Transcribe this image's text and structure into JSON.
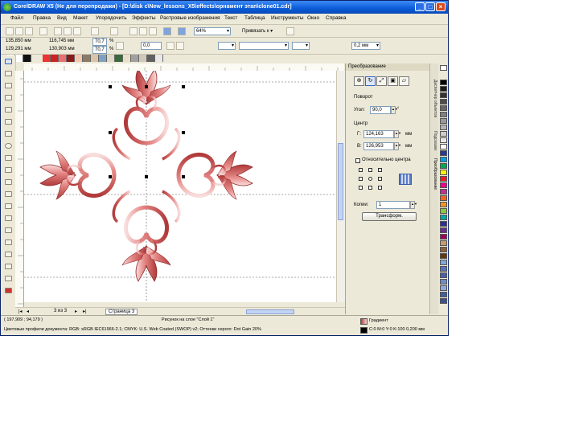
{
  "window": {
    "title": "CorelDRAW X5 (Не для перепродажи) - [D:\\disk c\\New_lessons_X5\\effects\\орнамент этап\\clone01.cdr]",
    "min_label": "_",
    "max_label": "□",
    "close_label": "×"
  },
  "menu": [
    "Файл",
    "Правка",
    "Вид",
    "Макет",
    "Упорядочить",
    "Эффекты",
    "Растровые изображения",
    "Текст",
    "Таблица",
    "Инструменты",
    "Окно",
    "Справка"
  ],
  "toolbar": {
    "zoom": "64%",
    "snap_label": "Привязать к ▾"
  },
  "property_bar": {
    "x": "135,850 мм",
    "y": "129,291 мм",
    "width": "116,745 мм",
    "height": "130,903 мм",
    "scale_x": "70,7",
    "scale_y": "70,7",
    "pct": "%",
    "rotation": "0,0",
    "outline": "0,2 мм"
  },
  "docker": {
    "title": "Преобразование",
    "rotation_heading": "Поворот",
    "angle_label": "Угол:",
    "angle_value": "90,0",
    "degree": "°",
    "center_heading": "Центр",
    "cx_label": "Г:",
    "cx_value": "124,163",
    "cy_label": "В:",
    "cy_value": "126,953",
    "unit": "мм",
    "relative_label": "Относительно центра",
    "copies_label": "Копии:",
    "copies_value": "1",
    "apply_button": "Трансформ."
  },
  "side_tabs": [
    "Диспетчер объектов",
    "Подсказки",
    "Преобразование"
  ],
  "page_nav": {
    "counter": "3 из 3",
    "page_tab": "Страница 3"
  },
  "status": {
    "left_line1": "( 197,909 ; 94,179 )",
    "selection_text": "Рисунок на слое \"Слой 1\"",
    "left_line2": "Цветовые профили документа: RGB: sRGB IEC61966-2.1; CMYK: U.S. Web Coated (SWOP) v2; Оттенки серого: Dot Gain 20%",
    "fill_label": "Градиент",
    "outline_label": "C:0 M:0 Y:0 K:100  0,200 мм"
  },
  "colors": {
    "ornament_dark": "#b03a3a",
    "ornament_light": "#f5d0cf",
    "accent": "#0a5bd8"
  }
}
